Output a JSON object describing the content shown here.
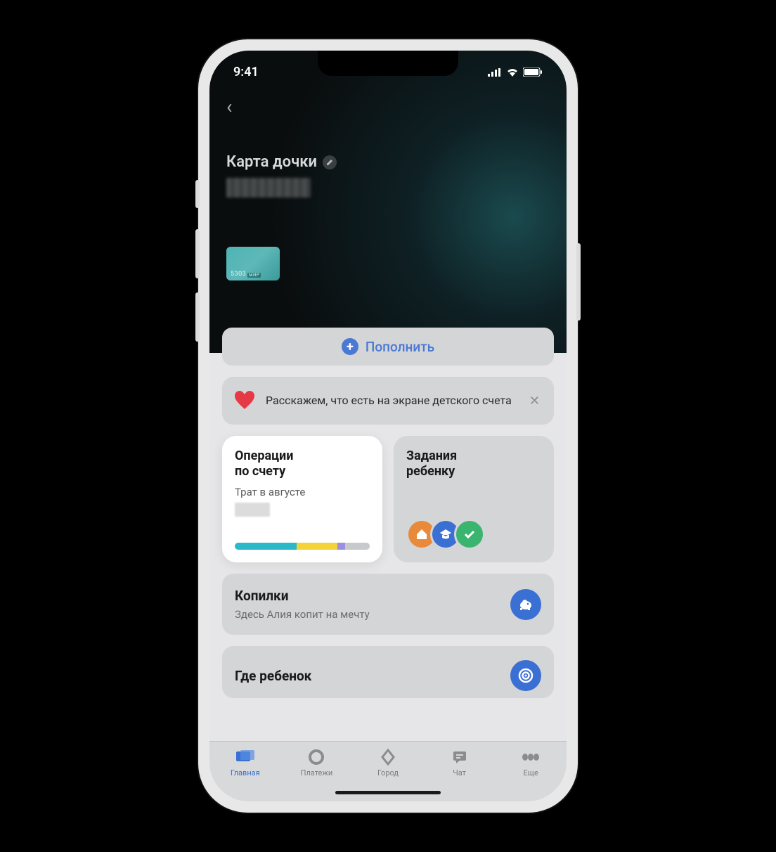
{
  "status": {
    "time": "9:41"
  },
  "header": {
    "title": "Карта дочки",
    "card_digits": "5303"
  },
  "actions": {
    "topup": "Пополнить"
  },
  "info_banner": {
    "text": "Расскажем, что есть на экране детского счета"
  },
  "tiles": {
    "operations": {
      "title_line1": "Операции",
      "title_line2": "по счету",
      "subtitle": "Трат в августе"
    },
    "tasks": {
      "title_line1": "Задания",
      "title_line2": "ребенку"
    }
  },
  "piggy": {
    "title": "Копилки",
    "subtitle": "Здесь Алия копит на мечту"
  },
  "location": {
    "title": "Где ребенок"
  },
  "tabs": {
    "home": "Главная",
    "payments": "Платежи",
    "city": "Город",
    "chat": "Чат",
    "more": "Еще"
  }
}
